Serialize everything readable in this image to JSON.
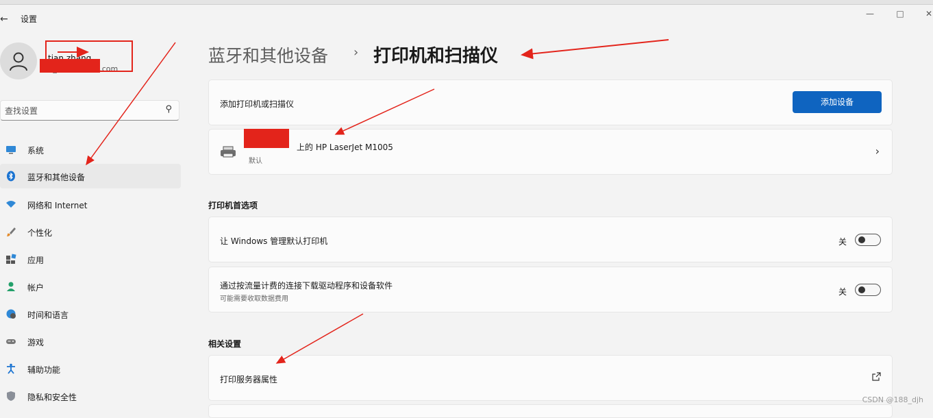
{
  "window": {
    "app_title": "设置",
    "back_icon": "arrow-left-icon",
    "minimize_icon": "minimize-icon",
    "maximize_icon": "maximize-icon",
    "close_icon": "close-icon"
  },
  "user": {
    "name": "tian zhang",
    "email": "tj_...@outlook.com",
    "avatar_icon": "person-icon"
  },
  "search": {
    "placeholder": "查找设置",
    "icon": "search-icon"
  },
  "sidebar": {
    "items": [
      {
        "label": "系统",
        "icon": "monitor-icon"
      },
      {
        "label": "蓝牙和其他设备",
        "icon": "bluetooth-icon",
        "active": true
      },
      {
        "label": "网络和 Internet",
        "icon": "wifi-icon"
      },
      {
        "label": "个性化",
        "icon": "brush-icon"
      },
      {
        "label": "应用",
        "icon": "apps-icon"
      },
      {
        "label": "帐户",
        "icon": "account-icon"
      },
      {
        "label": "时间和语言",
        "icon": "globe-clock-icon"
      },
      {
        "label": "游戏",
        "icon": "gamepad-icon"
      },
      {
        "label": "辅助功能",
        "icon": "accessibility-icon"
      },
      {
        "label": "隐私和安全性",
        "icon": "shield-icon"
      }
    ]
  },
  "header": {
    "breadcrumb_parent": "蓝牙和其他设备",
    "separator": "›",
    "title": "打印机和扫描仪"
  },
  "add_card": {
    "label": "添加打印机或扫描仪",
    "button": "添加设备"
  },
  "printer_card": {
    "name": "HP LaserJet M1005",
    "name_prefix": "上的",
    "status": "默认",
    "icon": "printer-icon",
    "chevron": "chevron-right-icon"
  },
  "preferences": {
    "section_title": "打印机首选项",
    "items": [
      {
        "label": "让 Windows 管理默认打印机",
        "sub": "",
        "state": "关",
        "on": false
      },
      {
        "label": "通过按流量计费的连接下载驱动程序和设备软件",
        "sub": "可能需要收取数据费用",
        "state": "关",
        "on": false
      }
    ]
  },
  "related": {
    "section_title": "相关设置",
    "items": [
      {
        "label": "打印服务器属性",
        "icon": "external-link-icon"
      }
    ]
  },
  "watermark": "CSDN @188_djh",
  "colors": {
    "accent": "#0f64c0",
    "annotation": "#e3241b",
    "background": "#f3f3f3",
    "card": "#fbfbfb"
  }
}
